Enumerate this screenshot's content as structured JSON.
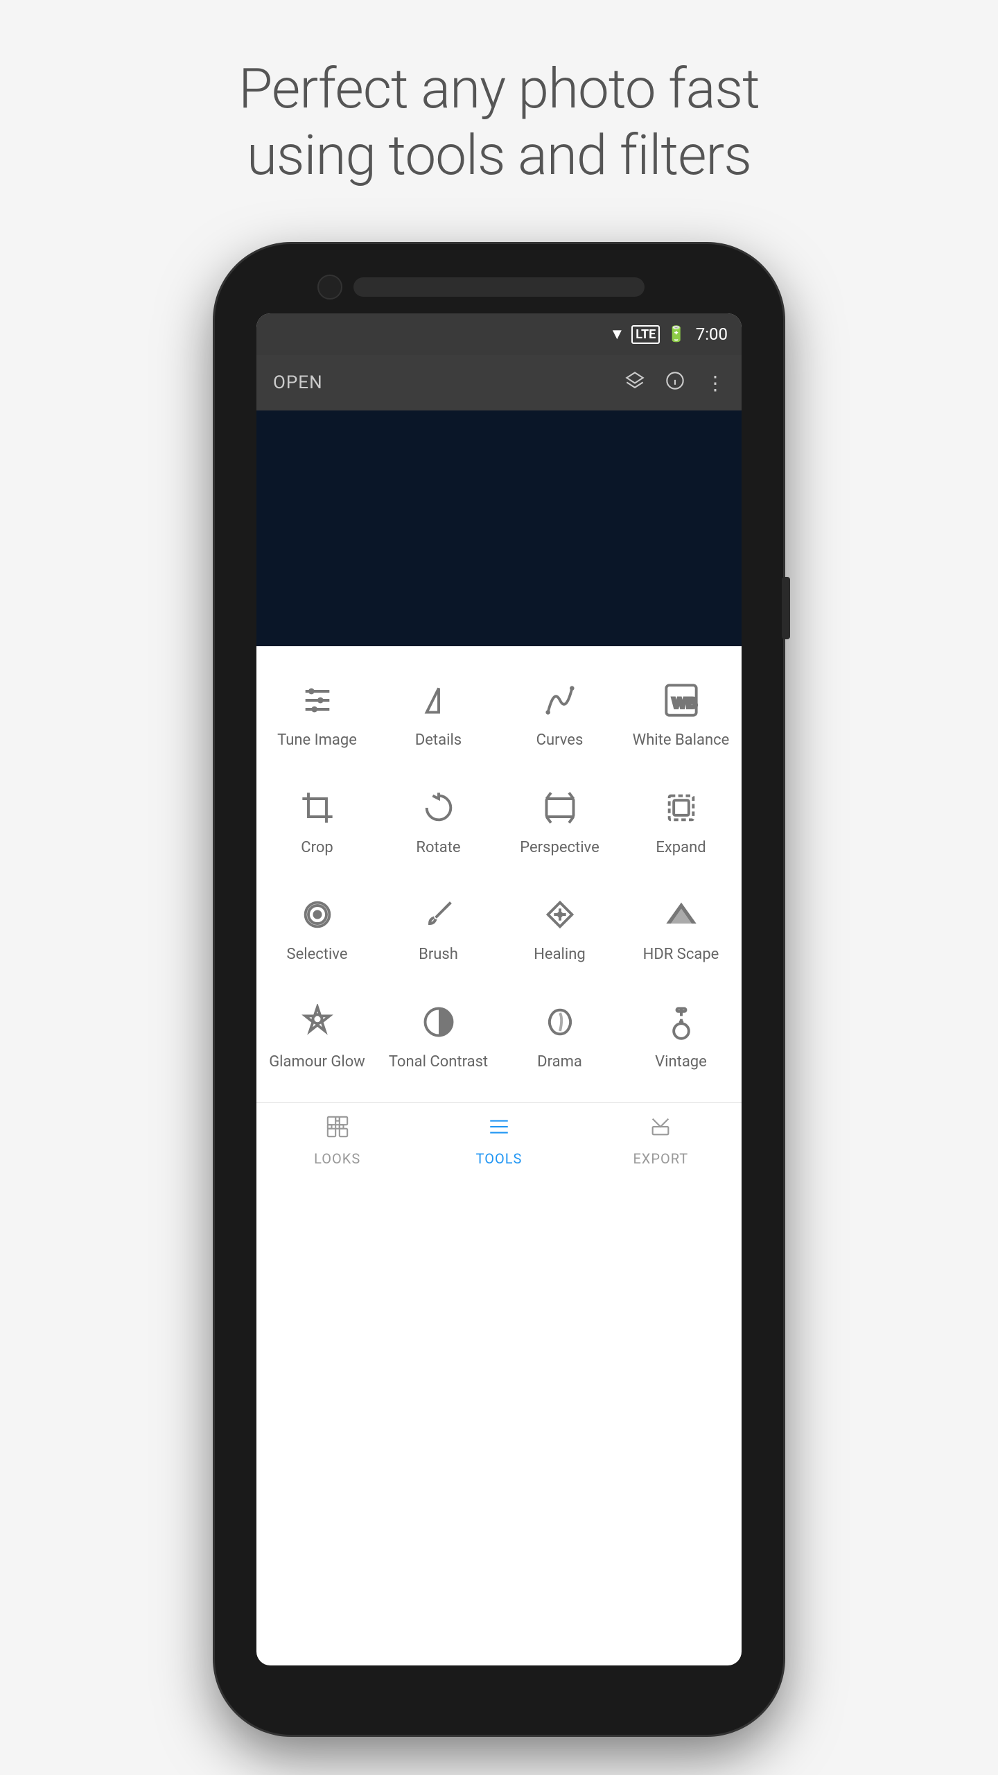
{
  "headline": {
    "line1": "Perfect any photo fast",
    "line2": "using tools and filters"
  },
  "statusBar": {
    "time": "7:00"
  },
  "toolbar": {
    "open_label": "OPEN"
  },
  "tools": [
    {
      "id": "tune-image",
      "label": "Tune Image",
      "icon": "tune"
    },
    {
      "id": "details",
      "label": "Details",
      "icon": "details"
    },
    {
      "id": "curves",
      "label": "Curves",
      "icon": "curves"
    },
    {
      "id": "white-balance",
      "label": "White\nBalance",
      "icon": "wb"
    },
    {
      "id": "crop",
      "label": "Crop",
      "icon": "crop"
    },
    {
      "id": "rotate",
      "label": "Rotate",
      "icon": "rotate"
    },
    {
      "id": "perspective",
      "label": "Perspective",
      "icon": "perspective"
    },
    {
      "id": "expand",
      "label": "Expand",
      "icon": "expand"
    },
    {
      "id": "selective",
      "label": "Selective",
      "icon": "selective"
    },
    {
      "id": "brush",
      "label": "Brush",
      "icon": "brush"
    },
    {
      "id": "healing",
      "label": "Healing",
      "icon": "healing"
    },
    {
      "id": "hdr-scape",
      "label": "HDR Scape",
      "icon": "hdr"
    },
    {
      "id": "glamour-glow",
      "label": "Glamour\nGlow",
      "icon": "glamour"
    },
    {
      "id": "tonal-contrast",
      "label": "Tonal\nContrast",
      "icon": "tonal"
    },
    {
      "id": "drama",
      "label": "Drama",
      "icon": "drama"
    },
    {
      "id": "vintage",
      "label": "Vintage",
      "icon": "vintage"
    }
  ],
  "bottomNav": [
    {
      "id": "looks",
      "label": "LOOKS",
      "active": false
    },
    {
      "id": "tools",
      "label": "TOOLS",
      "active": true
    },
    {
      "id": "export",
      "label": "EXPORT",
      "active": false
    }
  ]
}
